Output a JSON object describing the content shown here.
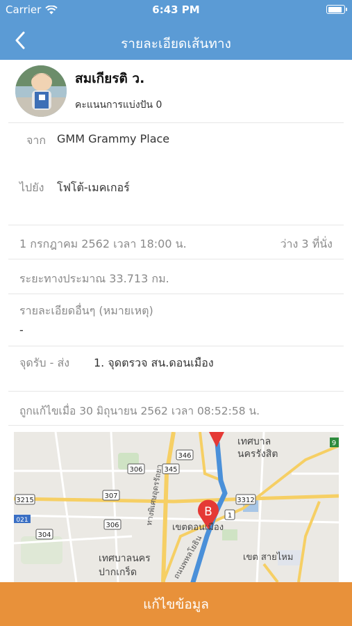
{
  "status_bar": {
    "carrier": "Carrier",
    "time": "6:43 PM",
    "battery_level": 0.9
  },
  "nav": {
    "title": "รายละเอียดเส้นทาง"
  },
  "profile": {
    "name": "สมเกียรติ ว.",
    "score": "คะแนนการแบ่งปัน 0"
  },
  "route": {
    "from_label": "จาก",
    "from_value": "GMM Grammy Place",
    "to_label": "ไปยัง",
    "to_value": "โฟโต้-เมคเกอร์"
  },
  "trip": {
    "datetime": "1 กรกฎาคม 2562 เวลา 18:00 น.",
    "seats": "ว่าง 3 ที่นั่ง",
    "distance": "ระยะทางประมาณ 33.713 กม.",
    "details_label": "รายละเอียดอื่นๆ (หมายเหตุ)",
    "details_value": "-",
    "pickup_label": "จุดรับ - ส่ง",
    "pickup_value": "1. จุดตรวจ สน.ดอนเมือง",
    "edited": "ถูกแก้ไขเมื่อ 30 มิถุนายน 2562 เวลา 08:52:58 น."
  },
  "map": {
    "labels": {
      "area_1_line1": "เทศบาล",
      "area_1_line2": "นครรังสิต",
      "area_2": "เขตดอนเมือง",
      "area_3": "เขต สายไหม",
      "area_4_line1": "เทศบาลนคร",
      "area_4_line2": "ปากเกร็ด",
      "road_1": "ทางพิเศษอุดรรัถยา",
      "road_2": "ถนนพหลโยธิน"
    },
    "shields": {
      "s346": "346",
      "s306a": "306",
      "s345": "345",
      "s307": "307",
      "s3215": "3215",
      "s3312": "3312",
      "s306b": "306",
      "s304": "304",
      "s1": "1",
      "s9": "9",
      "s021": "021"
    },
    "marker_b": "B"
  },
  "action": {
    "edit_label": "แก้ไขข้อมูล"
  },
  "colors": {
    "header": "#5b9bd5",
    "action": "#e8913a",
    "route": "#4a90d9",
    "marker": "#e53935"
  }
}
